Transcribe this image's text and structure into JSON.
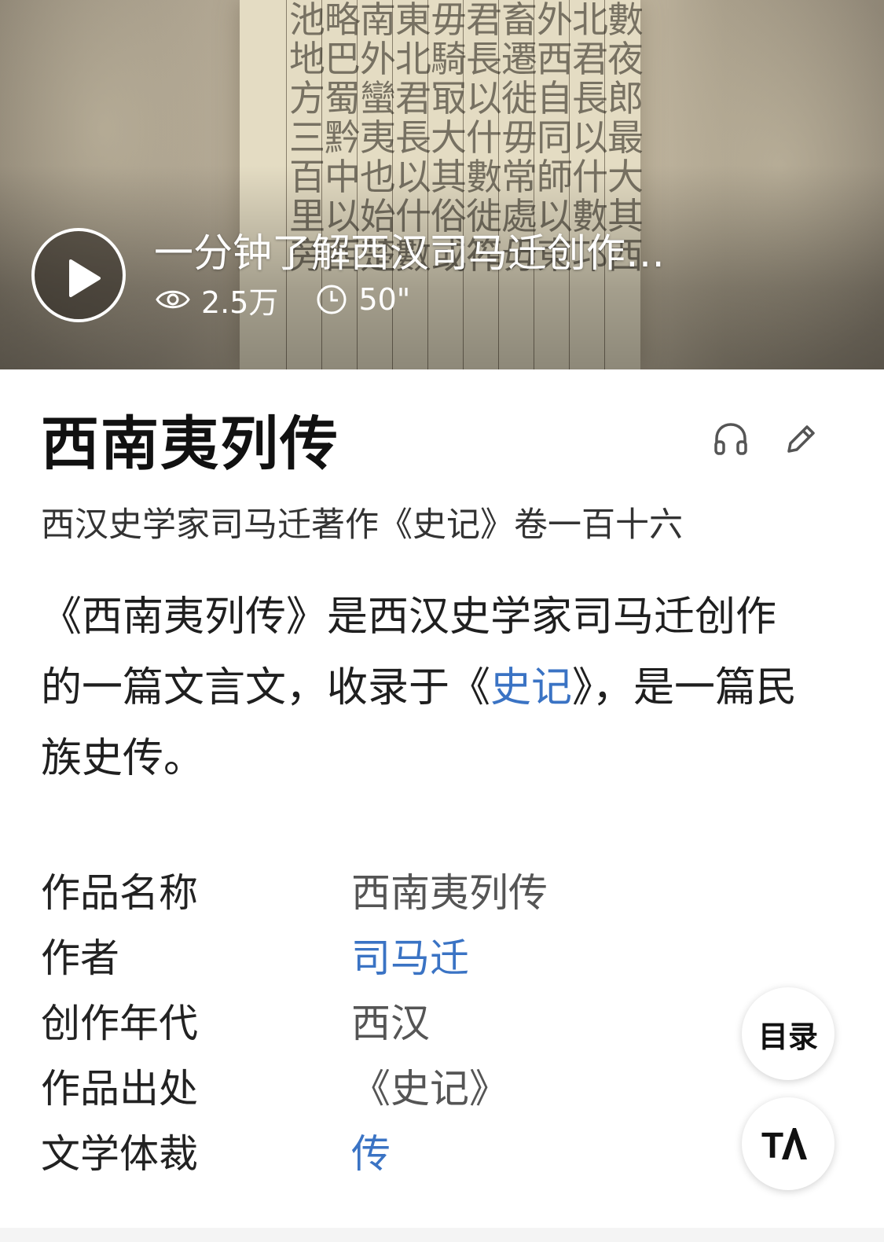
{
  "video": {
    "title": "一分钟了解西汉司马迁创作…",
    "views": "2.5万",
    "duration": "50\"",
    "thumbnail_columns": [
      "數夜郎最大其西",
      "北君長以什數邛",
      "外西自同師以東",
      "畜遷徙毋常處毋",
      "君長以什數徙筰",
      "毋騎冣大其俗或",
      "東北君長以什數",
      "南外蠻夷也始楚",
      "略巴蜀黔中以西",
      "池地方三百里旁"
    ]
  },
  "article": {
    "title": "西南夷列传",
    "subtitle": "西汉史学家司马迁著作《史记》卷一百十六",
    "summary_part1": "《西南夷列传》是西汉史学家司马迁创作的一篇文言文，收录于《",
    "summary_link": "史记",
    "summary_part2": "》，是一篇民族史传。"
  },
  "info_rows": [
    {
      "label": "作品名称",
      "value": "西南夷列传",
      "is_link": false
    },
    {
      "label": "作者",
      "value": "司马迁",
      "is_link": true
    },
    {
      "label": "创作年代",
      "value": "西汉",
      "is_link": false
    },
    {
      "label": "作品出处",
      "value": "《史记》",
      "is_link": false
    },
    {
      "label": "文学体裁",
      "value": "传",
      "is_link": true
    }
  ],
  "floating": {
    "toc_label": "目录",
    "font_label": "TA"
  },
  "colors": {
    "link": "#3a73c4",
    "title": "#111111",
    "body": "#1f1f1f"
  },
  "icons": [
    "play-icon",
    "views-eye-icon",
    "duration-clock-icon",
    "headphones-icon",
    "edit-pencil-icon",
    "font-size-icon"
  ]
}
